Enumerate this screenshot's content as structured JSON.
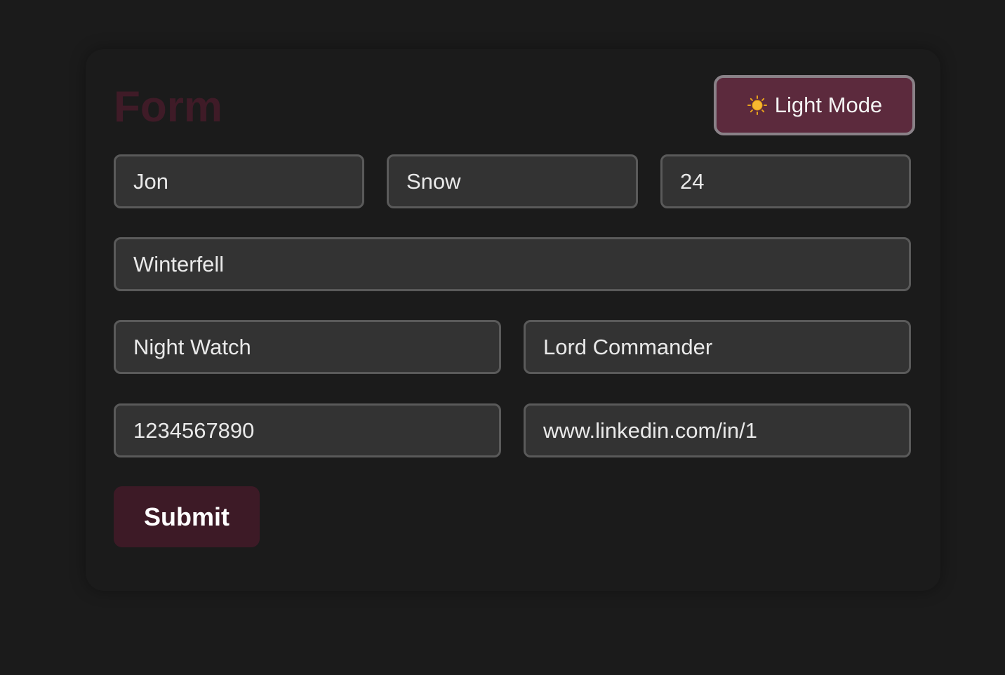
{
  "form": {
    "title": "Form",
    "theme_toggle": {
      "icon": "sun-icon",
      "label": "Light Mode"
    },
    "fields": {
      "first_name": "Jon",
      "last_name": "Snow",
      "age": "24",
      "city": "Winterfell",
      "organization": "Night Watch",
      "role": "Lord Commander",
      "phone": "1234567890",
      "linkedin": "www.linkedin.com/in/1"
    },
    "submit_label": "Submit"
  },
  "colors": {
    "background": "#1b1b1b",
    "field_background": "#333333",
    "field_border": "#5a5a5a",
    "title": "#3f1b27",
    "toggle_background": "#5c2a3d",
    "toggle_border": "#8a8288",
    "submit_background": "#3d1a26",
    "text": "#e9e9e9"
  }
}
